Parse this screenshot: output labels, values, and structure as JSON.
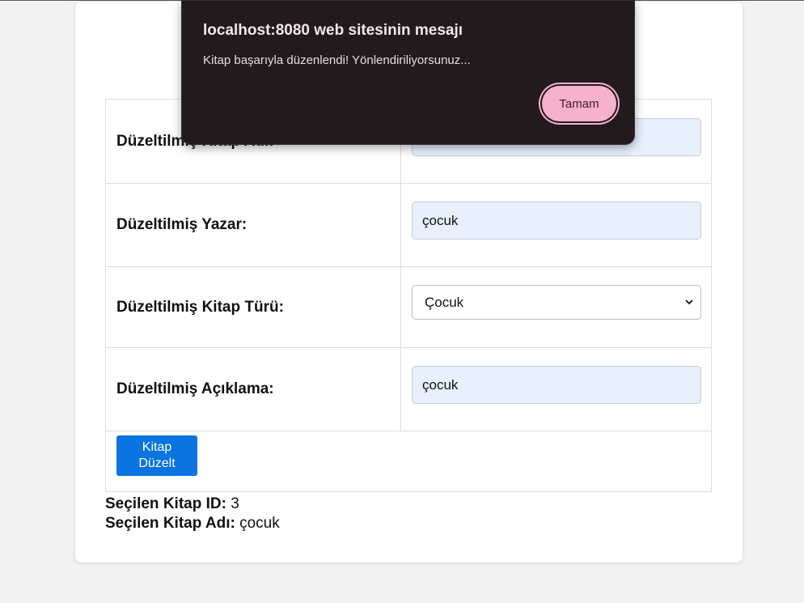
{
  "form": {
    "row1_label": "Düzeltilmiş Kitap Adı:",
    "row1_value": "",
    "author_label": "Düzeltilmiş Yazar:",
    "author_value": "çocuk",
    "genre_label": "Düzeltilmiş Kitap Türü:",
    "genre_value": "Çocuk",
    "description_label": "Düzeltilmiş Açıklama:",
    "description_value": "çocuk",
    "submit_label_line1": "Kitap",
    "submit_label_line2": "Düzelt"
  },
  "info": {
    "id_label": "Seçilen Kitap ID:",
    "id_value": "3",
    "name_label": "Seçilen Kitap Adı:",
    "name_value": "çocuk"
  },
  "dialog": {
    "title": "localhost:8080 web sitesinin mesajı",
    "message": "Kitap başarıyla düzenlendi! Yönlendiriliyorsunuz...",
    "ok_label": "Tamam"
  },
  "colors": {
    "page_bg": "#f3f3f3",
    "button_blue": "#0a74e0",
    "input_autofill": "#e8f0fe",
    "dialog_bg": "#231a1e",
    "dialog_button": "#f6b1cd"
  }
}
